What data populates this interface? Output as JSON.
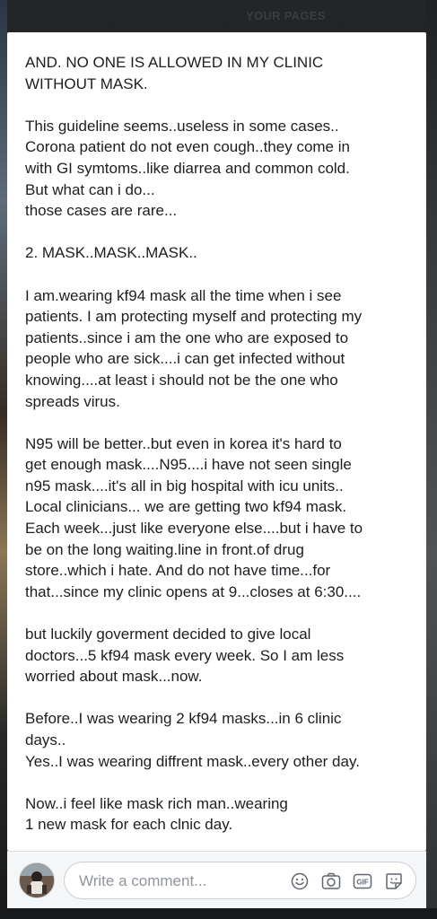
{
  "header": {
    "your_pages": "YOUR PAGES"
  },
  "post": {
    "paragraphs": [
      [
        "AND. NO ONE IS ALLOWED IN MY CLINIC",
        "WITHOUT MASK."
      ],
      [
        "This guideline seems..useless in some cases..",
        "Corona patient do not even cough..they come in",
        "with GI symtoms..like diarrea and common cold.",
        "But what can i do...",
        "those cases are rare..."
      ],
      [
        "2. MASK..MASK..MASK.."
      ],
      [
        "I am.wearing kf94 mask all the time when i see",
        "patients. I am protecting myself and protecting my",
        "patients..since i am the one who are exposed to",
        "people who are sick....i can get infected without",
        "knowing....at least i should not be the one who",
        "spreads virus."
      ],
      [
        "N95 will be better..but even in korea it's hard to",
        "get enough mask....N95....i have not seen single",
        "n95 mask....it's all in big hospital with icu units..",
        "Local clinicians... we are getting two kf94 mask.",
        "Each week...just like everyone else....but i have to",
        "be on the long waiting.line in front.of drug",
        "store..which i hate. And do not have time...for",
        "that...since my clinic opens at 9...closes at 6:30...."
      ],
      [
        "but luckily goverment decided to give local",
        "doctors...5 kf94 mask every week. So I am less",
        "worried about mask...now."
      ],
      [
        "Before..I was wearing 2 kf94 masks...in 6 clinic",
        "days..",
        "Yes..I was wearing diffrent mask..every other day."
      ],
      [
        "Now..i feel like mask rich man..wearing",
        "1 new mask for each clnic day."
      ]
    ]
  },
  "comment": {
    "placeholder": "Write a comment...",
    "icons": [
      "emoji-icon",
      "camera-icon",
      "gif-icon",
      "sticker-icon"
    ]
  }
}
